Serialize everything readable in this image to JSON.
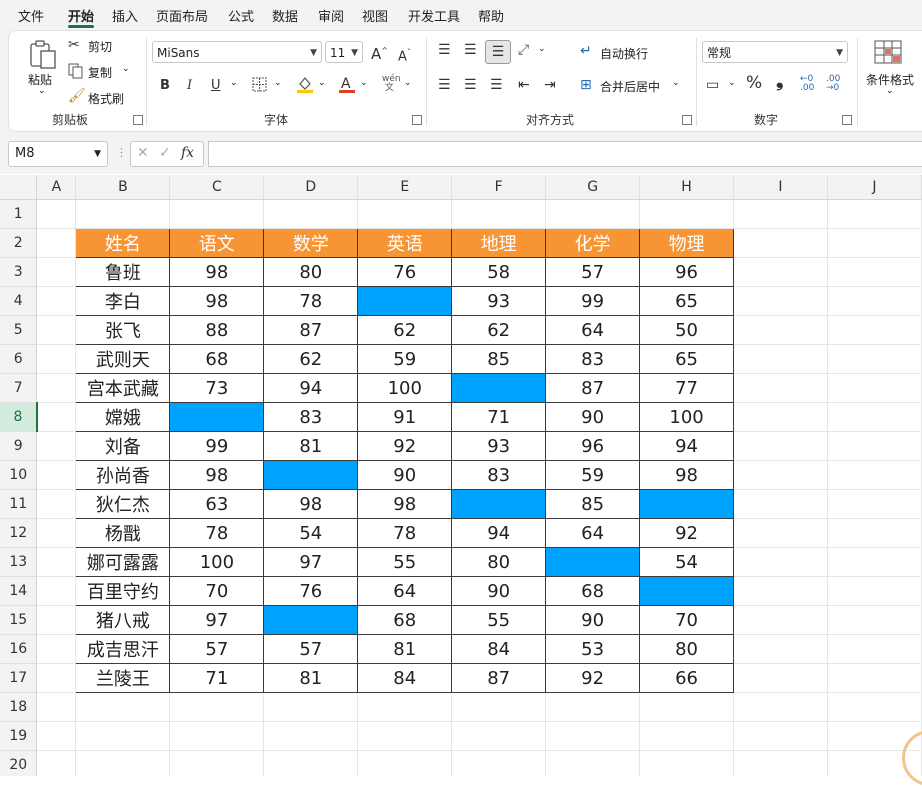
{
  "menu": {
    "items": [
      "文件",
      "开始",
      "插入",
      "页面布局",
      "公式",
      "数据",
      "审阅",
      "视图",
      "开发工具",
      "帮助"
    ],
    "active": "开始"
  },
  "ribbon": {
    "clipboard": {
      "paste": "粘贴",
      "cut": "剪切",
      "copy": "复制",
      "format_painter": "格式刷",
      "label": "剪贴板"
    },
    "font": {
      "name": "MiSans",
      "size": "11",
      "bold": "B",
      "italic": "I",
      "underline": "U",
      "label": "字体"
    },
    "alignment": {
      "wrap": "自动换行",
      "merge": "合并后居中",
      "label": "对齐方式"
    },
    "number": {
      "format": "常规",
      "percent": "%",
      "comma": "❟",
      "label": "数字"
    },
    "styles": {
      "conditional": "条件格式"
    }
  },
  "formula_bar": {
    "name_box": "M8",
    "fx": "fx",
    "value": ""
  },
  "sheet": {
    "columns": [
      "A",
      "B",
      "C",
      "D",
      "E",
      "F",
      "G",
      "H",
      "I",
      "J"
    ],
    "rows": [
      "1",
      "2",
      "3",
      "4",
      "5",
      "6",
      "7",
      "8",
      "9",
      "10",
      "11",
      "12",
      "13",
      "14",
      "15",
      "16",
      "17",
      "18",
      "19",
      "20"
    ],
    "selected_row": "8",
    "headers": [
      "姓名",
      "语文",
      "数学",
      "英语",
      "地理",
      "化学",
      "物理"
    ],
    "data": [
      [
        "鲁班",
        "98",
        "80",
        "76",
        "58",
        "57",
        "96"
      ],
      [
        "李白",
        "98",
        "78",
        "",
        "93",
        "99",
        "65"
      ],
      [
        "张飞",
        "88",
        "87",
        "62",
        "62",
        "64",
        "50"
      ],
      [
        "武则天",
        "68",
        "62",
        "59",
        "85",
        "83",
        "65"
      ],
      [
        "宫本武藏",
        "73",
        "94",
        "100",
        "",
        "87",
        "77"
      ],
      [
        "嫦娥",
        "",
        "83",
        "91",
        "71",
        "90",
        "100"
      ],
      [
        "刘备",
        "99",
        "81",
        "92",
        "93",
        "96",
        "94"
      ],
      [
        "孙尚香",
        "98",
        "",
        "90",
        "83",
        "59",
        "98"
      ],
      [
        "狄仁杰",
        "63",
        "98",
        "98",
        "",
        "85",
        ""
      ],
      [
        "杨戬",
        "78",
        "54",
        "78",
        "94",
        "64",
        "92"
      ],
      [
        "娜可露露",
        "100",
        "97",
        "55",
        "80",
        "",
        "54"
      ],
      [
        "百里守约",
        "70",
        "76",
        "64",
        "90",
        "68",
        ""
      ],
      [
        "猪八戒",
        "97",
        "",
        "68",
        "55",
        "90",
        "70"
      ],
      [
        "成吉思汗",
        "57",
        "57",
        "81",
        "84",
        "53",
        "80"
      ],
      [
        "兰陵王",
        "71",
        "81",
        "84",
        "87",
        "92",
        "66"
      ]
    ]
  },
  "colors": {
    "header_fill": "#f79433",
    "blank_fill": "#00a2ff",
    "accent": "#1e7145"
  }
}
